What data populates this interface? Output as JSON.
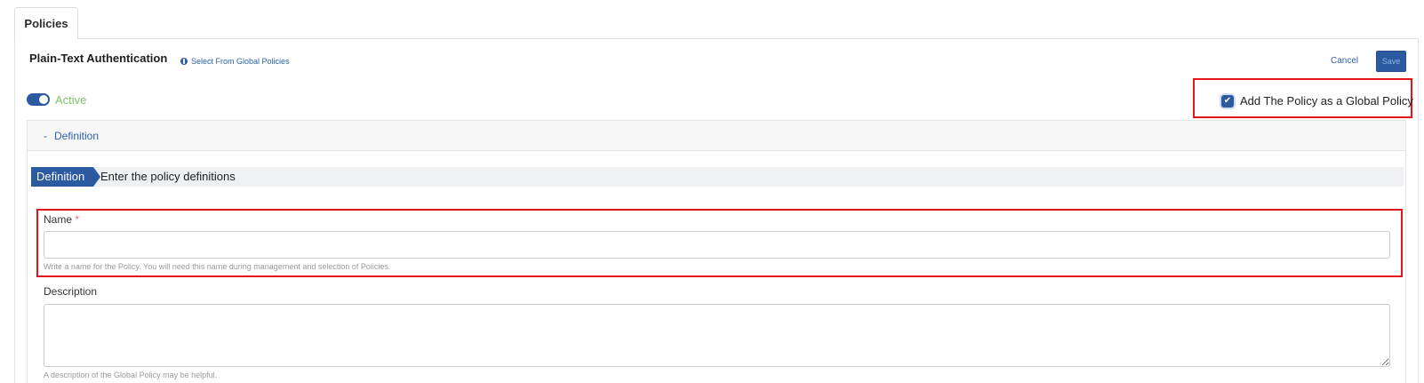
{
  "tab": {
    "label": "Policies"
  },
  "header": {
    "title": "Plain-Text Authentication",
    "global_link": "Select From Global Policies",
    "cancel_label": "Cancel",
    "save_label": "Save"
  },
  "status": {
    "active_label": "Active",
    "active": true
  },
  "global_policy": {
    "label": "Add The Policy as a Global Policy",
    "checked": true
  },
  "section": {
    "toggle_symbol": "-",
    "header_label": "Definition",
    "tag_label": "Definition",
    "description": "Enter the policy definitions"
  },
  "form": {
    "name_label": "Name",
    "required_mark": "*",
    "name_value": "",
    "name_hint": "Write a name for the Policy. You will need this name during management and selection of Policies.",
    "description_label": "Description",
    "description_value": "",
    "description_hint": "A description of the Global Policy may be helpful."
  },
  "colors": {
    "accent": "#2b5aa0",
    "active_green": "#7cc36a",
    "highlight_red": "#e3141b"
  }
}
